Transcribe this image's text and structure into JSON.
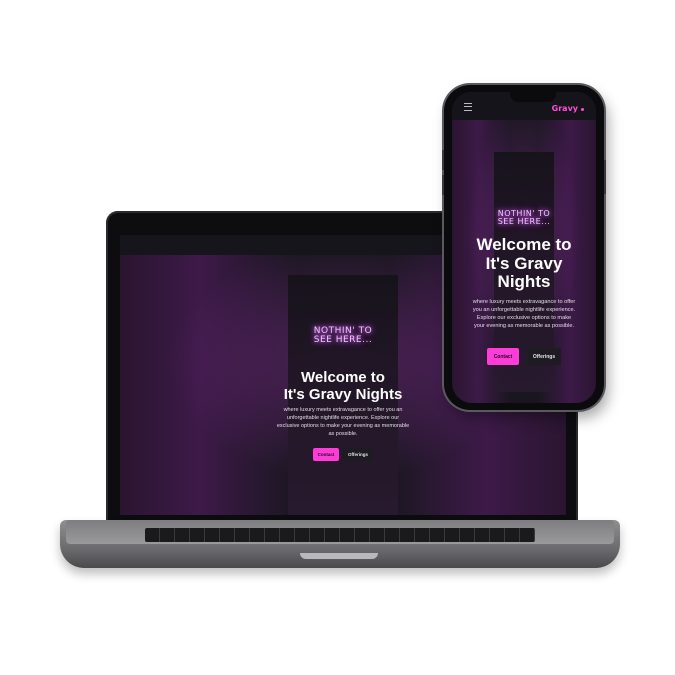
{
  "laptop": {
    "neon_sign": [
      "NOTHIN' TO",
      "SEE HERE..."
    ],
    "hero": {
      "title_line1": "Welcome to",
      "title_line2": "It's Gravy Nights",
      "text_lines": [
        "where luxury meets extravagance to offer you an",
        "unforgettable nightlife experience. Explore our",
        "exclusive options to make your evening as memorable",
        "as possible."
      ],
      "contact_label": "Contact",
      "offerings_label": "Offerings"
    }
  },
  "phone": {
    "brand": "Gravy",
    "neon_sign": [
      "NOTHIN' TO",
      "SEE HERE..."
    ],
    "hero": {
      "title_line1": "Welcome to",
      "title_line2": "It's Gravy",
      "title_line3": "Nights",
      "text_lines": [
        "where luxury meets extravagance to offer",
        "you an unforgettable nightlife experience.",
        "Explore our exclusive options to make",
        "your evening as memorable as possible."
      ],
      "contact_label": "Contact",
      "offerings_label": "Offerings"
    }
  },
  "colors": {
    "accent": "#ff3bd8",
    "hero_overlay": "#1b1822",
    "neon": "#f2c7ff"
  },
  "icons": [
    "hamburger-menu-icon"
  ]
}
